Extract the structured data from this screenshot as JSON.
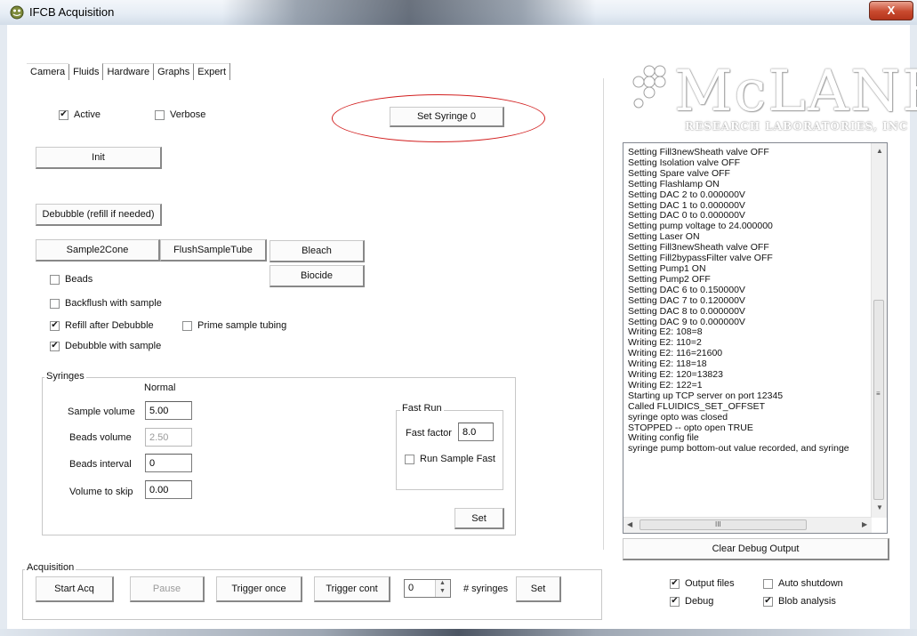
{
  "window": {
    "title": "IFCB Acquisition",
    "close_glyph": "X",
    "app_icon": "ifcb-app-icon"
  },
  "tabs": [
    {
      "label": "Camera"
    },
    {
      "label": "Fluids",
      "active": true
    },
    {
      "label": "Hardware"
    },
    {
      "label": "Graphs"
    },
    {
      "label": "Expert"
    }
  ],
  "fluids": {
    "active": {
      "label": "Active",
      "checked": true
    },
    "verbose": {
      "label": "Verbose",
      "checked": false
    },
    "set_syringe_label": "Set Syringe 0",
    "init_label": "Init",
    "debubble_label": "Debubble (refill if needed)",
    "sample2cone_label": "Sample2Cone",
    "flush_label": "FlushSampleTube",
    "bleach_label": "Bleach",
    "biocide_label": "Biocide",
    "beads": {
      "label": "Beads",
      "checked": false
    },
    "backflush": {
      "label": "Backflush with sample",
      "checked": false
    },
    "refill_after": {
      "label": "Refill after Debubble",
      "checked": true
    },
    "prime": {
      "label": "Prime sample tubing",
      "checked": false
    },
    "debubble_with_sample": {
      "label": "Debubble with sample",
      "checked": true
    }
  },
  "syringes": {
    "group_label": "Syringes",
    "normal_label": "Normal",
    "sample_volume": {
      "label": "Sample volume",
      "value": "5.00"
    },
    "beads_volume": {
      "label": "Beads volume",
      "value": "2.50"
    },
    "beads_interval": {
      "label": "Beads interval",
      "value": "0"
    },
    "volume_to_skip": {
      "label": "Volume to skip",
      "value": "0.00"
    },
    "fast_run_label": "Fast Run",
    "fast_factor": {
      "label": "Fast factor",
      "value": "8.0"
    },
    "run_sample_fast": {
      "label": "Run Sample Fast",
      "checked": false
    },
    "set_label": "Set"
  },
  "logo": {
    "name": "McLANE",
    "subtitle": "RESEARCH LABORATORIES, INC"
  },
  "debug_log": [
    "Setting Fill3newSheath valve OFF",
    "Setting Isolation valve OFF",
    "Setting Spare valve OFF",
    "Setting Flashlamp ON",
    "Setting DAC 2 to 0.000000V",
    "Setting DAC 1 to 0.000000V",
    "Setting DAC 0 to 0.000000V",
    "Setting pump voltage to 24.000000",
    "Setting Laser ON",
    "Setting Fill3newSheath valve OFF",
    "Setting Fill2bypassFilter valve OFF",
    "Setting Pump1 ON",
    "Setting Pump2 OFF",
    "Setting DAC 6 to 0.150000V",
    "Setting DAC 7 to 0.120000V",
    "Setting DAC 8 to 0.000000V",
    "Setting DAC 9 to 0.000000V",
    "Writing E2: 108=8",
    "Writing E2: 110=2",
    "Writing E2: 116=21600",
    "Writing E2: 118=18",
    "Writing E2: 120=13823",
    "Writing E2: 122=1",
    "Starting up TCP server on port 12345",
    "Called FLUIDICS_SET_OFFSET",
    "syringe opto was closed",
    "STOPPED -- opto open TRUE",
    "Writing config file",
    "syringe pump bottom-out value recorded, and syringe"
  ],
  "scroll_glyphs": {
    "up": "▲",
    "down": "▼",
    "left": "◀",
    "right": "▶",
    "grip": "≡",
    "hgrip": "III"
  },
  "clear_debug_label": "Clear Debug Output",
  "acquisition": {
    "group_label": "Acquisition",
    "start_label": "Start Acq",
    "pause_label": "Pause",
    "trigger_once_label": "Trigger once",
    "trigger_cont_label": "Trigger cont",
    "syringe_count": "0",
    "syringes_label": "# syringes",
    "set_label": "Set"
  },
  "options": {
    "output_files": {
      "label": "Output files",
      "checked": true
    },
    "auto_shutdown": {
      "label": "Auto shutdown",
      "checked": false
    },
    "debug": {
      "label": "Debug",
      "checked": true
    },
    "blob_analysis": {
      "label": "Blob analysis",
      "checked": true
    }
  },
  "colors": {
    "annotation_ellipse": "#d21f1f",
    "close_button": "#c8492e"
  }
}
